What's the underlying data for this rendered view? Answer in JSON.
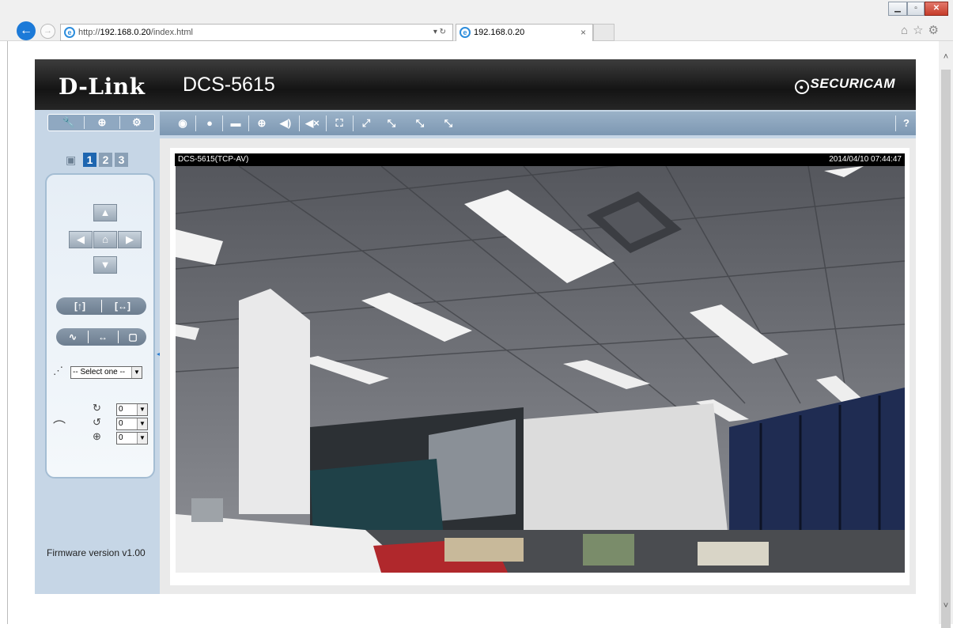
{
  "browser": {
    "back_icon": "back-arrow-icon",
    "forward_icon": "forward-arrow-icon",
    "url_prefix": "http://",
    "url_host": "192.168.0.20",
    "url_path": "/index.html",
    "address_controls": "▾ ↻",
    "tab_title": "192.168.0.20",
    "tab_close": "×",
    "window_controls": {
      "minimize": "▁",
      "maximize": "▫",
      "close": "✕"
    },
    "right_icons": "⌂☆⚙"
  },
  "header": {
    "brand": "D-Link",
    "model": "DCS-5615",
    "securicam": "SECURICAM"
  },
  "toolbar": {
    "left_buttons": [
      {
        "name": "setup-icon",
        "glyph": "🔧"
      },
      {
        "name": "globe-icon",
        "glyph": "⊕"
      },
      {
        "name": "gear-icon",
        "glyph": "⚙"
      }
    ],
    "main_buttons": [
      {
        "name": "snapshot-icon",
        "glyph": "◉"
      },
      {
        "name": "record-icon",
        "glyph": "●"
      },
      {
        "name": "folder-icon",
        "glyph": "▬"
      },
      {
        "name": "zoom-in-icon",
        "glyph": "⊕"
      },
      {
        "name": "volume-icon",
        "glyph": "◀)"
      },
      {
        "name": "mute-icon",
        "glyph": "◀×"
      },
      {
        "name": "fullscreen-icon",
        "glyph": "⛶"
      },
      {
        "name": "resize-icon",
        "glyph": "⤢"
      },
      {
        "name": "size-100-icon",
        "glyph": "⤡"
      },
      {
        "name": "size-50-icon",
        "glyph": "⤡"
      },
      {
        "name": "size-25-icon",
        "glyph": "⤡"
      }
    ],
    "help": "?"
  },
  "leftpanel": {
    "view_numbers": [
      "1",
      "2",
      "3"
    ],
    "dpad": {
      "up": "▲",
      "left": "◀",
      "home": "⌂",
      "right": "▶",
      "down": "▼"
    },
    "pill1": {
      "a": "[↑]",
      "b": "[↔]"
    },
    "pill2": {
      "a": "∿",
      "b": "↔",
      "c": "▢"
    },
    "preset_select": "-- Select one --",
    "speed_values": [
      "0",
      "0",
      "0"
    ],
    "firmware": "Firmware version v1.00"
  },
  "video": {
    "stream_name": "DCS-5615(TCP-AV)",
    "timestamp": "2014/04/10 07:44:47"
  }
}
